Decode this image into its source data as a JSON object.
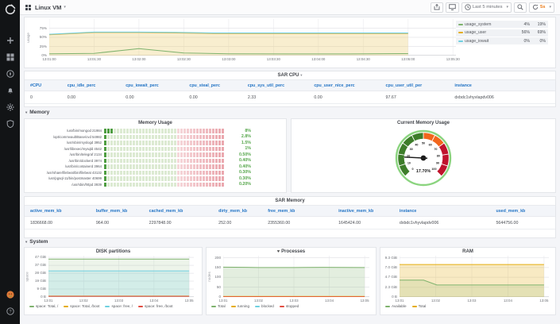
{
  "topbar": {
    "dashboard_title": "Linux VM",
    "time_range": "Last 5 minutes",
    "refresh_interval": "5s"
  },
  "icons": {
    "caret_down": "▾",
    "heart": "♥",
    "question": "?",
    "plus": "+"
  },
  "sections": {
    "memory": "Memory",
    "system": "System"
  },
  "cpu_panel": {
    "ylabel": "usage",
    "legend": [
      {
        "name": "usage_system",
        "color": "#7eb26d",
        "avg": "4%",
        "max": "19%"
      },
      {
        "name": "usage_user",
        "color": "#e5ac0e",
        "avg": "56%",
        "max": "69%"
      },
      {
        "name": "usage_iowait",
        "color": "#6ed0e0",
        "avg": "0%",
        "max": "0%"
      }
    ],
    "chart": {
      "type": "area",
      "ymax": 100,
      "tmax": 272,
      "yticks": [
        {
          "label": "75%",
          "v": 75
        },
        {
          "label": "50%",
          "v": 50
        },
        {
          "label": "25%",
          "v": 25
        },
        {
          "label": "0%",
          "v": 0
        }
      ],
      "xticks": [
        {
          "label": "13:01:00",
          "t": 0
        },
        {
          "label": "13:01:30",
          "t": 30
        },
        {
          "label": "13:02:00",
          "t": 60
        },
        {
          "label": "13:02:30",
          "t": 90
        },
        {
          "label": "13:03:00",
          "t": 120
        },
        {
          "label": "13:03:30",
          "t": 150
        },
        {
          "label": "13:04:00",
          "t": 180
        },
        {
          "label": "13:04:30",
          "t": 210
        },
        {
          "label": "13:05:00",
          "t": 240
        },
        {
          "label": "13:05:30",
          "t": 270
        }
      ],
      "series": [
        {
          "name": "usage_user",
          "color": "#d8b54d",
          "width": 1,
          "fill": "#e8c96a",
          "fillOpacity": 0.32,
          "points": [
            [
              0,
              57
            ],
            [
              30,
              63
            ],
            [
              60,
              63
            ],
            [
              85,
              62
            ],
            [
              110,
              60.5
            ],
            [
              150,
              60.5
            ],
            [
              200,
              60.5
            ],
            [
              240,
              60.5
            ]
          ]
        },
        {
          "name": "usage_iowait",
          "color": "#6ed0e0",
          "width": 1,
          "points": [
            [
              0,
              58.4
            ],
            [
              30,
              64.4
            ],
            [
              60,
              64.4
            ],
            [
              85,
              63.4
            ],
            [
              110,
              61.9
            ],
            [
              150,
              61.9
            ],
            [
              200,
              61.9
            ],
            [
              240,
              61.9
            ]
          ]
        },
        {
          "name": "usage_system",
          "color": "#7eb26d",
          "width": 1,
          "points": [
            [
              0,
              5
            ],
            [
              30,
              6
            ],
            [
              60,
              19
            ],
            [
              90,
              7
            ],
            [
              120,
              5
            ],
            [
              160,
              4.5
            ],
            [
              200,
              4.5
            ],
            [
              240,
              5.5
            ]
          ]
        }
      ]
    }
  },
  "sar_cpu": {
    "title": "SAR CPU",
    "columns": [
      "#CPU",
      "cpu_idle_perc",
      "cpu_iowait_perc",
      "cpu_steal_perc",
      "cpu_sys_util_perc",
      "cpu_user_nice_perc",
      "cpu_user_util_per",
      "instance"
    ],
    "rows": [
      [
        "0",
        "0.00",
        "0.00",
        "0.00",
        "2.33",
        "0.00",
        "97.67",
        "dxbdc1vhyvlapdv006"
      ]
    ]
  },
  "memory_usage": {
    "title": "Memory Usage",
    "rows": [
      {
        "label": "/usr/bin/mongod 21984",
        "value": "8%",
        "pct": 8
      },
      {
        "label": "/opt/commvault/Base/cvd 54982",
        "value": "2.8%",
        "pct": 2.8
      },
      {
        "label": "/usr/sbin/rsyslogd 3952",
        "value": "1.5%",
        "pct": 1.5
      },
      {
        "label": "/usr/libexec/mysqld 4542",
        "value": "1%",
        "pct": 1
      },
      {
        "label": "/usr/bin/telegraf 2134",
        "value": "0.50%",
        "pct": 0.5
      },
      {
        "label": "/usr/bin/dockerd 3974",
        "value": "0.40%",
        "pct": 0.4
      },
      {
        "label": "/usr/bin/containerd 3964",
        "value": "0.40%",
        "pct": 0.4
      },
      {
        "label": "/usr/share/filebeat/bin/filebeat 43132",
        "value": "0.30%",
        "pct": 0.3
      },
      {
        "label": "/usr/pgsql-11/bin/postmaster 40699",
        "value": "0.30%",
        "pct": 0.3
      },
      {
        "label": "/usr/sbin/httpd 3939",
        "value": "0.20%",
        "pct": 0.2
      }
    ]
  },
  "current_memory": {
    "title": "Current Memory Usage",
    "value": 17.7,
    "value_label": "17.70%",
    "min": 0,
    "max": 100,
    "tick_step": 10,
    "ring_color": "#8bd47f",
    "needle_color": "#1b1b1b",
    "thresholds": [
      {
        "to": 50,
        "color": "#3d7d2a"
      },
      {
        "to": 70,
        "color": "#f2661d"
      },
      {
        "to": 100,
        "color": "#c0132c"
      }
    ]
  },
  "sar_memory": {
    "title": "SAR Memory",
    "columns": [
      "active_mem_kb",
      "buffer_mem_kb",
      "cached_mem_kb",
      "dirty_mem_kb",
      "free_mem_kb",
      "inactive_mem_kb",
      "instance",
      "used_mem_kb"
    ],
    "rows": [
      [
        "1836668.00",
        "964.00",
        "2297848.00",
        "252.00",
        "2355360.00",
        "1645424.00",
        "dxbdc1vhyvlapdv006",
        "5644756.00"
      ]
    ]
  },
  "disk_panel": {
    "title": "DISK partitions",
    "ylabel": "space",
    "legend": [
      {
        "name": "space: Total, /",
        "color": "#7eb26d"
      },
      {
        "name": "space: Total, /boot",
        "color": "#e5ac0e"
      },
      {
        "name": "space: free, /",
        "color": "#6ed0e0"
      },
      {
        "name": "space: free, /boot",
        "color": "#e24d42"
      }
    ],
    "chart": {
      "type": "line",
      "ymax": 49,
      "tmax": 248,
      "yticks": [
        {
          "label": "47 GiB",
          "v": 47
        },
        {
          "label": "37 GiB",
          "v": 37.6
        },
        {
          "label": "28 GiB",
          "v": 28.2
        },
        {
          "label": "19 GiB",
          "v": 18.8
        },
        {
          "label": "9 GiB",
          "v": 9.4
        },
        {
          "label": "0 B",
          "v": 0
        }
      ],
      "xticks": [
        {
          "label": "13:01",
          "t": 0
        },
        {
          "label": "13:02",
          "t": 60
        },
        {
          "label": "13:03",
          "t": 120
        },
        {
          "label": "13:04",
          "t": 180
        },
        {
          "label": "13:05",
          "t": 240
        }
      ],
      "series": [
        {
          "name": "space: Total, /",
          "color": "#7eb26d",
          "width": 1,
          "fill": "#7eb26d",
          "fillOpacity": 0.14,
          "points": [
            [
              0,
              45
            ],
            [
              240,
              45
            ]
          ]
        },
        {
          "name": "space: free, /",
          "color": "#6ed0e0",
          "width": 1,
          "fill": "#6ed0e0",
          "fillOpacity": 0.2,
          "points": [
            [
              0,
              31
            ],
            [
              240,
              31
            ]
          ]
        },
        {
          "name": "space: Total, /boot",
          "color": "#e5ac0e",
          "width": 1,
          "points": [
            [
              0,
              1.0
            ],
            [
              240,
              1.0
            ]
          ]
        },
        {
          "name": "space: free, /boot",
          "color": "#e24d42",
          "width": 1,
          "points": [
            [
              0,
              0.85
            ],
            [
              240,
              0.85
            ]
          ]
        }
      ]
    }
  },
  "processes_panel": {
    "title": "Processes",
    "ylabel": "nodes",
    "legend": [
      {
        "name": "Total",
        "color": "#7eb26d"
      },
      {
        "name": "running",
        "color": "#e5ac0e"
      },
      {
        "name": "blocked",
        "color": "#6ed0e0"
      },
      {
        "name": "stopped",
        "color": "#e24d42"
      }
    ],
    "chart": {
      "type": "line",
      "ymax": 210,
      "tmax": 248,
      "yticks": [
        {
          "label": "200",
          "v": 200
        },
        {
          "label": "150",
          "v": 150
        },
        {
          "label": "100",
          "v": 100
        },
        {
          "label": "50",
          "v": 50
        },
        {
          "label": "0",
          "v": 0
        }
      ],
      "xticks": [
        {
          "label": "13:01",
          "t": 0
        },
        {
          "label": "13:02",
          "t": 60
        },
        {
          "label": "13:03",
          "t": 120
        },
        {
          "label": "13:04",
          "t": 180
        },
        {
          "label": "13:05",
          "t": 240
        }
      ],
      "series": [
        {
          "name": "Total",
          "color": "#7eb26d",
          "width": 1,
          "fill": "#7eb26d",
          "fillOpacity": 0.22,
          "points": [
            [
              0,
              152
            ],
            [
              40,
              151
            ],
            [
              60,
              150
            ],
            [
              120,
              150
            ],
            [
              170,
              151
            ],
            [
              240,
              150
            ]
          ]
        },
        {
          "name": "running",
          "color": "#e5ac0e",
          "width": 1,
          "points": [
            [
              0,
              3
            ],
            [
              240,
              3
            ]
          ]
        },
        {
          "name": "stopped",
          "color": "#e24d42",
          "width": 1,
          "points": [
            [
              0,
              1.2
            ],
            [
              240,
              1.2
            ]
          ]
        }
      ]
    }
  },
  "ram_panel": {
    "title": "RAM",
    "legend": [
      {
        "name": "Available",
        "color": "#7eb26d"
      },
      {
        "name": "Total",
        "color": "#e5ac0e"
      }
    ],
    "chart": {
      "type": "line",
      "ymax": 9.8,
      "tmax": 248,
      "yticks": [
        {
          "label": "9.3 GiB",
          "v": 9.3
        },
        {
          "label": "7.0 GiB",
          "v": 7.0
        },
        {
          "label": "4.7 GiB",
          "v": 4.7
        },
        {
          "label": "2.3 GiB",
          "v": 2.3
        },
        {
          "label": "0 B",
          "v": 0
        }
      ],
      "xticks": [
        {
          "label": "13:01",
          "t": 0
        },
        {
          "label": "13:02",
          "t": 60
        },
        {
          "label": "13:03",
          "t": 120
        },
        {
          "label": "13:04",
          "t": 180
        },
        {
          "label": "13:05",
          "t": 240
        }
      ],
      "series": [
        {
          "name": "Total",
          "color": "#e5ac0e",
          "width": 1,
          "fill": "#e5ac0e",
          "fillOpacity": 0.25,
          "points": [
            [
              0,
              7.7
            ],
            [
              240,
              7.7
            ]
          ]
        },
        {
          "name": "Available",
          "color": "#7eb26d",
          "width": 1,
          "fill": "#7eb26d",
          "fillOpacity": 0.16,
          "points": [
            [
              0,
              4.0
            ],
            [
              40,
              4.0
            ],
            [
              62,
              2.85
            ],
            [
              240,
              2.85
            ]
          ]
        }
      ]
    }
  }
}
